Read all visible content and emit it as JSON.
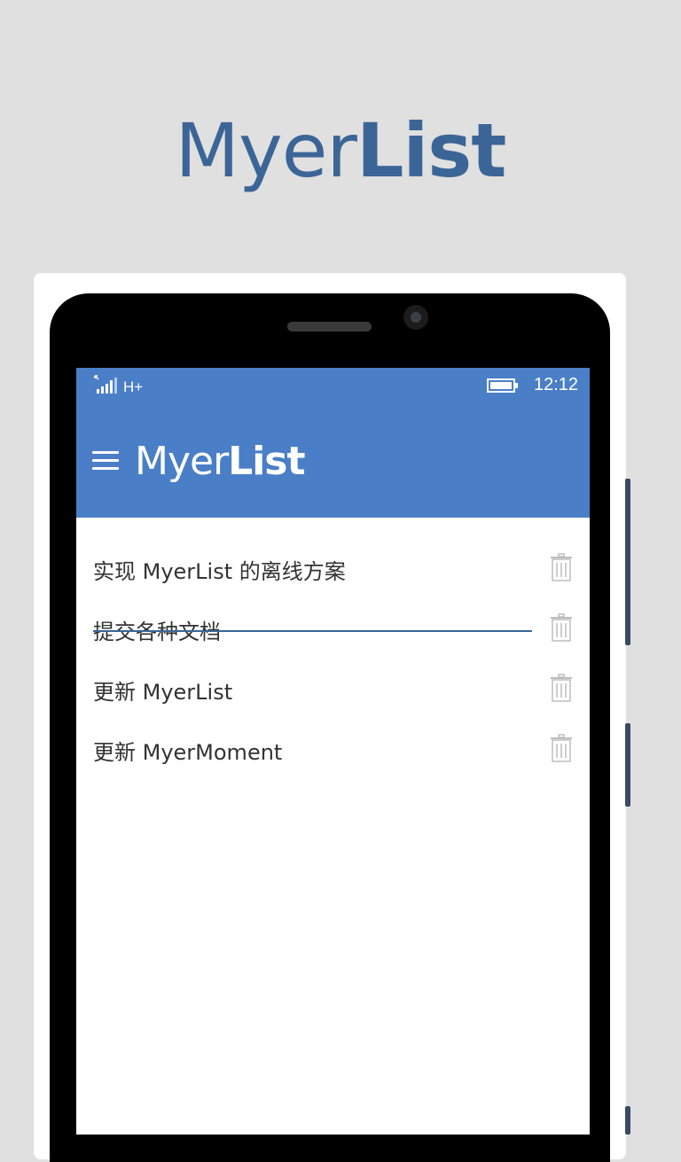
{
  "hero": {
    "title_light": "Myer",
    "title_bold": "List"
  },
  "status_bar": {
    "network": "H+",
    "time": "12:12"
  },
  "app_bar": {
    "title_light": "Myer",
    "title_bold": "List"
  },
  "todos": [
    {
      "text": "实现 MyerList 的离线方案",
      "completed": false
    },
    {
      "text": "提交各种文档",
      "completed": true
    },
    {
      "text": "更新 MyerList",
      "completed": false
    },
    {
      "text": "更新 MyerMoment",
      "completed": false
    }
  ],
  "colors": {
    "brand": "#3c6597",
    "app_bar": "#4a7fc7",
    "background": "#e0e0e0"
  },
  "icons": {
    "menu": "hamburger-menu-icon",
    "delete": "trash-icon",
    "signal": "signal-strength-icon",
    "battery": "battery-icon"
  }
}
